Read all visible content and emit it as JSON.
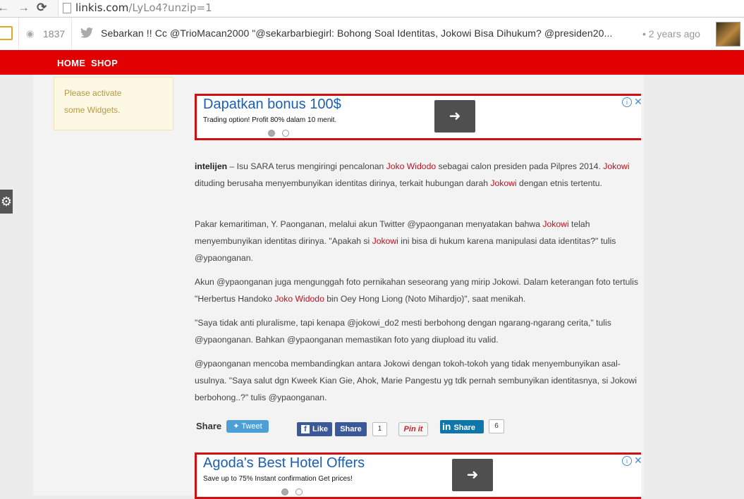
{
  "browser": {
    "back_glyph": "←",
    "forward_glyph": "→",
    "reload_glyph": "⟳",
    "url_host": "linkis.com",
    "url_path": "/LyLo4?unzip=1"
  },
  "linkis_bar": {
    "view_count": "1837",
    "tweet_text": "Sebarkan !! Cc @TrioMacan2000 \"@sekarbarbiegirl: Bohong Soal Identitas, Jokowi Bisa Dihukum? @presiden20...",
    "time_ago": "• 2 years ago"
  },
  "nav": {
    "home": "HOME",
    "shop": "SHOP"
  },
  "sidebar_widget": {
    "line1": "Please activate",
    "line2": "some Widgets."
  },
  "ad_top": {
    "title": "Dapatkan bonus 100$",
    "subtitle": "Trading option! Profit 80% dalam 10 menit.",
    "info_glyph": "i",
    "close_glyph": "✕",
    "arrow_glyph": "➜"
  },
  "ad_bottom": {
    "title": "Agoda's Best Hotel Offers",
    "subtitle": "Save up to 75% Instant confirmation Get prices!",
    "info_glyph": "i",
    "close_glyph": "✕",
    "arrow_glyph": "➜"
  },
  "article": {
    "p1": {
      "lead": "intelijen",
      "a": " – Isu SARA terus mengiringi pencalonan ",
      "k1": "Joko Widodo",
      "b": " sebagai calon presiden pada Pilpres 2014. ",
      "k2": "Jokowi",
      "c": " dituding berusaha menyembunyikan identitas dirinya, terkait hubungan darah ",
      "k3": "Jokowi",
      "d": " dengan etnis tertentu."
    },
    "p2": {
      "a": "Pakar kemaritiman, Y.  Paonganan, melalui akun Twitter @ypaonganan menyatakan bahwa ",
      "k1": "Jokowi",
      "b": " telah menyembunyikan identitas dirinya. \"Apakah si ",
      "k2": "Jokowi",
      "c": " ini bisa di hukum karena manipulasi data identitas?\" tulis @ypaonganan."
    },
    "p3": {
      "a": "Akun @ypaonganan juga mengunggah foto pernikahan seseorang yang mirip Jokowi.  Dalam keterangan foto tertulis \"Herbertus Handoko ",
      "k1": "Joko Widodo",
      "b": " bin Oey Hong Liong (Noto Mihardjo)\", saat menikah."
    },
    "p4": "\"Saya tidak anti pluralisme, tapi kenapa @jokowi_do2 mesti berbohong dengan ngarang-ngarang  cerita,\" tulis @ypaonganan. Bahkan @ypaonganan memastikan foto yang diupload itu valid.",
    "p5": "@ypaonganan mencoba membandingkan antara Jokowi dengan tokoh-tokoh yang tidak menyembunyikan asal-usulnya. \"Saya salut dgn Kweek Kian Gie, Ahok, Marie Pangestu yg tdk pernah sembunyikan identitasnya, si Jokowi berbohong..?\" tulis @ypaonganan."
  },
  "share": {
    "label": "Share",
    "tweet": "Tweet",
    "fb_like": "Like",
    "fb_share": "Share",
    "fb_count": "1",
    "pin": "Pin it",
    "in_share": "Share",
    "in_count": "6"
  }
}
